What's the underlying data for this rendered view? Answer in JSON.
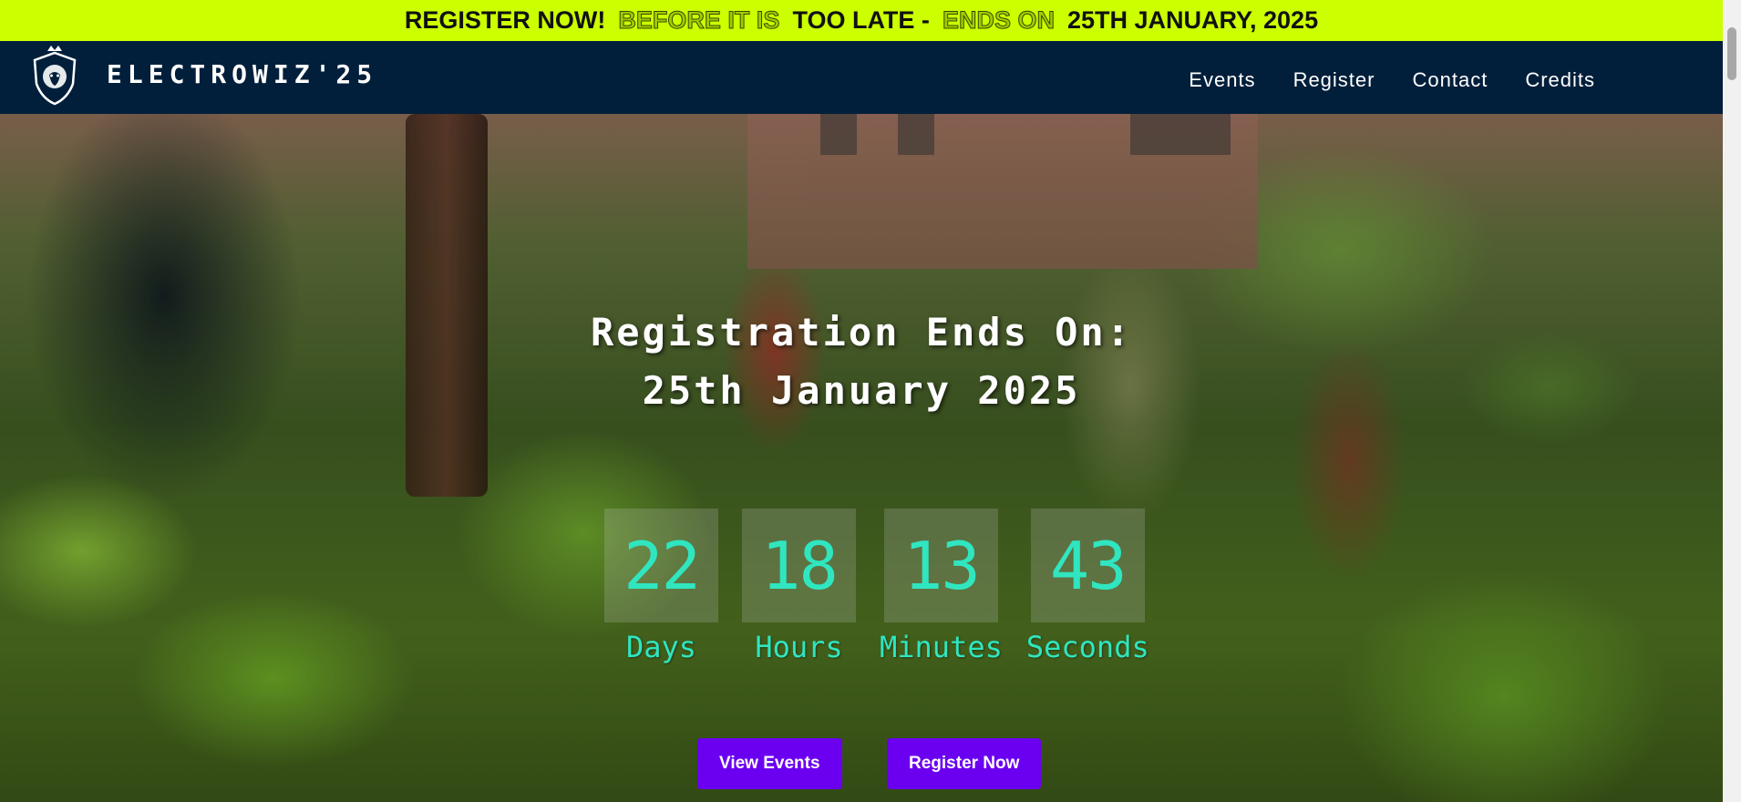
{
  "banner": {
    "part1": "REGISTER NOW!",
    "part2": "BEFORE IT IS",
    "part3": "TOO LATE -",
    "part4": "ENDS ON",
    "part5": "25TH JANUARY, 2025"
  },
  "navbar": {
    "brand": "ELECTROWIZ'25",
    "links": [
      "Events",
      "Register",
      "Contact",
      "Credits"
    ]
  },
  "hero": {
    "title_line1": "Registration Ends On:",
    "title_line2": "25th January 2025",
    "countdown": [
      {
        "value": "22",
        "label": "Days"
      },
      {
        "value": "18",
        "label": "Hours"
      },
      {
        "value": "13",
        "label": "Minutes"
      },
      {
        "value": "43",
        "label": "Seconds"
      }
    ],
    "buttons": {
      "view_events": "View Events",
      "register_now": "Register Now"
    }
  },
  "colors": {
    "banner_bg": "#ccff00",
    "navbar_bg": "#011f3b",
    "countdown_text": "#2fe6c0",
    "button_bg": "#6b00f0"
  }
}
